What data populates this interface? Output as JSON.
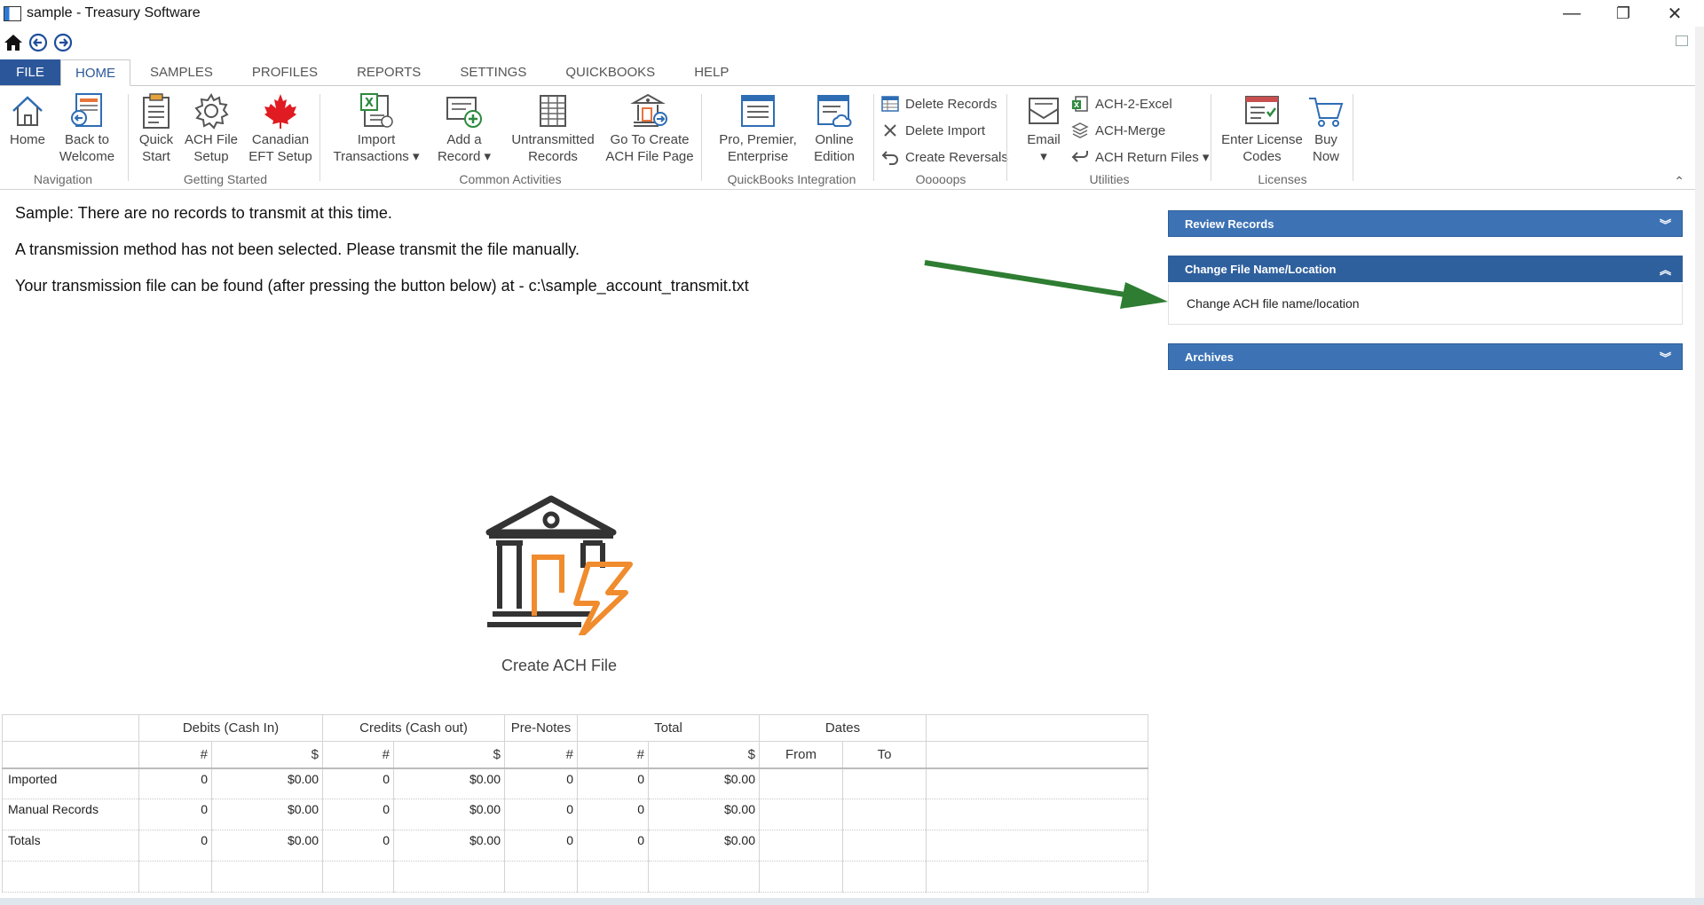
{
  "window": {
    "title": "sample - Treasury Software",
    "controls": {
      "minimize": "—",
      "restore": "❐",
      "close": "✕"
    }
  },
  "tabs": [
    "FILE",
    "HOME",
    "SAMPLES",
    "PROFILES",
    "REPORTS",
    "SETTINGS",
    "QUICKBOOKS",
    "HELP"
  ],
  "ribbon": {
    "navigation": {
      "label": "Navigation",
      "home": "Home",
      "back_to_welcome": "Back to\nWelcome"
    },
    "getting_started": {
      "label": "Getting Started",
      "quick_start": "Quick\nStart",
      "ach_file_setup": "ACH File\nSetup",
      "canadian_eft_setup": "Canadian\nEFT Setup"
    },
    "common_activities": {
      "label": "Common Activities",
      "import_transactions": "Import\nTransactions ▾",
      "add_a_record": "Add a\nRecord ▾",
      "untransmitted_records": "Untransmitted\nRecords",
      "go_to_create": "Go To Create\nACH File Page"
    },
    "quickbooks_integration": {
      "label": "QuickBooks Integration",
      "pro_premier": "Pro, Premier,\nEnterprise",
      "online_edition": "Online\nEdition"
    },
    "ooooops": {
      "label": "Ooooops",
      "delete_records": "Delete Records",
      "delete_import": "Delete Import",
      "create_reversals": "Create Reversals"
    },
    "utilities": {
      "label": "Utilities",
      "email": "Email\n▾",
      "ach_2_excel": "ACH-2-Excel",
      "ach_merge": "ACH-Merge",
      "ach_return_files": "ACH Return Files ▾"
    },
    "licenses": {
      "label": "Licenses",
      "enter_license_codes": "Enter License\nCodes",
      "buy_now": "Buy\nNow"
    }
  },
  "messages": {
    "line1": "Sample:  There are no records to transmit at this time.",
    "line2": "A transmission method has not been selected.  Please transmit the file manually.",
    "line3": "Your transmission file can be found (after pressing the button below) at - c:\\sample_account_transmit.txt"
  },
  "panels": {
    "review_records": "Review Records",
    "change_file": "Change File Name/Location",
    "change_file_link": "Change ACH file name/location",
    "archives": "Archives"
  },
  "create_ach": {
    "label": "Create ACH File"
  },
  "summary_table": {
    "group_headers": [
      "Debits (Cash In)",
      "Credits (Cash out)",
      "Pre-Notes",
      "Total",
      "Dates"
    ],
    "sub_headers": [
      "#",
      "$",
      "#",
      "$",
      "#",
      "#",
      "$",
      "From",
      "To"
    ],
    "rows": [
      {
        "label": "Imported",
        "values": [
          "0",
          "$0.00",
          "0",
          "$0.00",
          "0",
          "0",
          "$0.00",
          "",
          ""
        ]
      },
      {
        "label": "Manual Records",
        "values": [
          "0",
          "$0.00",
          "0",
          "$0.00",
          "0",
          "0",
          "$0.00",
          "",
          ""
        ]
      },
      {
        "label": "Totals",
        "values": [
          "0",
          "$0.00",
          "0",
          "$0.00",
          "0",
          "0",
          "$0.00",
          "",
          ""
        ]
      }
    ]
  },
  "colors": {
    "accent": "#2b579a",
    "panel_header": "#3d73b5",
    "arrow": "#2e7d32",
    "ach_orange": "#f08c2e"
  }
}
